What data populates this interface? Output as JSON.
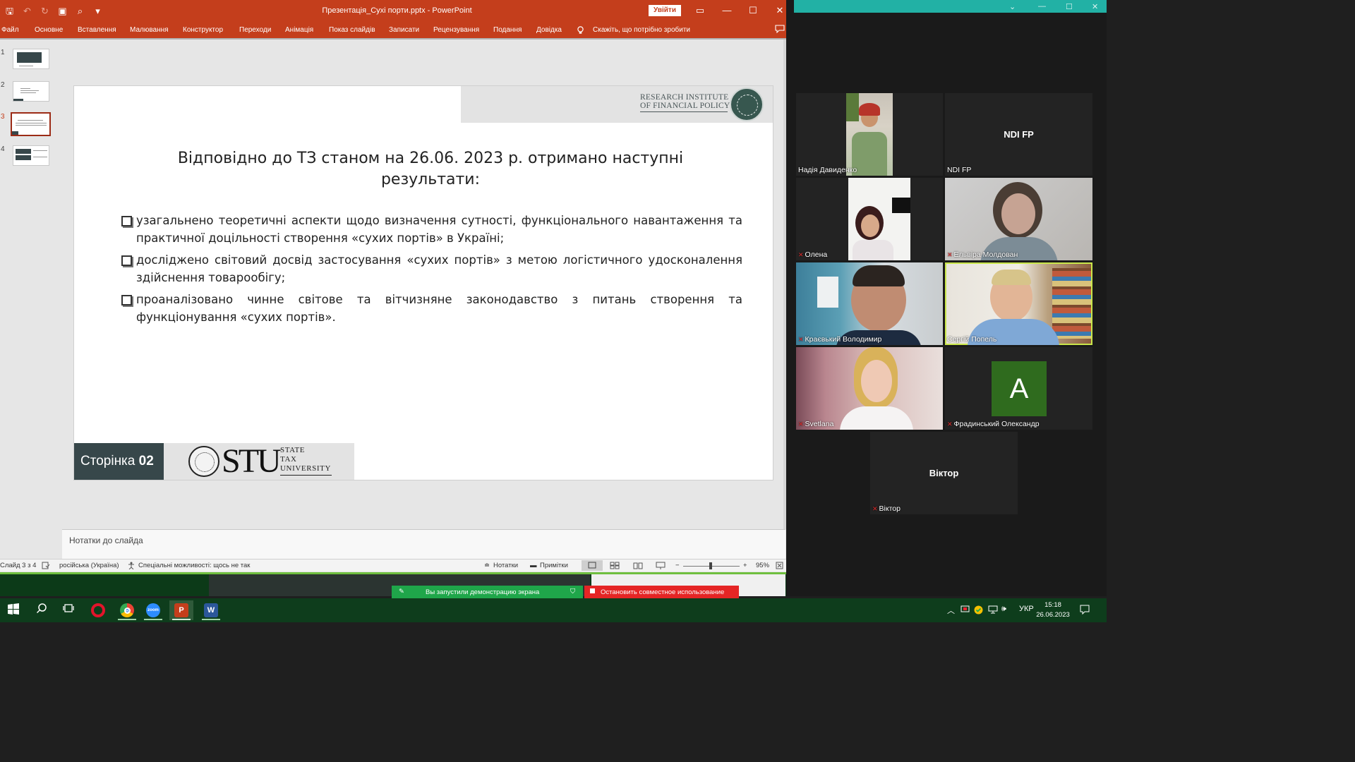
{
  "powerpoint": {
    "window_title": "Презентація_Сухі порти.pptx  -  PowerPoint",
    "signin_label": "Увійти",
    "qat": {
      "save": "🖫",
      "undo": "↶",
      "redo": "↻",
      "present": "▣",
      "preview": "⌕",
      "customize": "▾"
    },
    "window_controls": {
      "ribbon_display": "▭",
      "minimize": "—",
      "maximize": "☐",
      "close": "✕"
    },
    "ribbon_tabs": [
      "Файл",
      "Основне",
      "Вставлення",
      "Малювання",
      "Конструктор",
      "Переходи",
      "Анімація",
      "Показ слайдів",
      "Записати",
      "Рецензування",
      "Подання",
      "Довідка"
    ],
    "tellme": "Скажіть, що потрібно зробити",
    "thumbnails": [
      "1",
      "2",
      "3",
      "4"
    ],
    "selected_slide": 3,
    "slide": {
      "header_logo_line1": "RESEARCH INSTITUTE",
      "header_logo_line2": "OF FINANCIAL POLICY",
      "title": "Відповідно до ТЗ станом на 26.06. 2023 р. отримано наступні результати:",
      "bullets": [
        "узагальнено теоретичні аспекти щодо визначення сутності, функціонального навантаження та практичної доцільності створення «сухих портів» в Україні;",
        "досліджено світовий досвід застосування «сухих портів» з метою логістичного удосконалення здійснення товарообігу;",
        "проаналізовано чинне світове та вітчизняне законодавство з питань створення та функціонування «сухих портів»."
      ],
      "footer_page_label": "Сторінка",
      "footer_page_num": "02",
      "footer_logo_main": "STU",
      "footer_logo_sub1": "STATE",
      "footer_logo_sub2": "TAX",
      "footer_logo_sub3": "UNIVERSITY"
    },
    "notes_placeholder": "Нотатки до слайда",
    "status": {
      "slide_info": "Слайд 3 з 4",
      "language": "російська (Україна)",
      "accessibility": "Спеціальні можливості: щось не так",
      "notes_btn": "Нотатки",
      "comments_btn": "Примітки",
      "zoom_minus": "−",
      "zoom_plus": "+",
      "zoom": "95%"
    }
  },
  "zoom_meeting": {
    "window_controls": {
      "minimize": "—",
      "maximize": "☐",
      "close": "✕",
      "collapse": "⌄"
    },
    "participants": [
      {
        "name": "Надія Давиденко",
        "muted": false
      },
      {
        "name": "NDI FP",
        "muted": false,
        "label": "NDI FP"
      },
      {
        "name": "Олена",
        "muted": true
      },
      {
        "name": "Ельвіра Молдован",
        "muted": true
      },
      {
        "name": "Краєвький Володимир",
        "muted": true
      },
      {
        "name": "Сергій Попель",
        "muted": false
      },
      {
        "name": "Svetlana",
        "muted": true
      },
      {
        "name": "Фрадинський Олександр",
        "muted": true,
        "avatar": "A"
      },
      {
        "name": "Віктор",
        "muted": true,
        "label": "Віктор"
      }
    ],
    "share_banner": "Вы запустили демонстрацию экрана",
    "stop_share": "Остановить совместное использование"
  },
  "taskbar": {
    "apps": [
      "Opera",
      "Chrome",
      "Zoom",
      "PowerPoint",
      "Word"
    ],
    "zoom_app_label": "zoom",
    "powerpoint_glyph": "P",
    "word_glyph": "W",
    "chrome_glyph": "H",
    "language": "УКР",
    "time": "15:18",
    "date": "26.06.2023"
  },
  "colors": {
    "powerpoint_accent": "#c43e1c",
    "slide_dark": "#37474a",
    "zoom_accent": "#22b1a5",
    "taskbar": "#0e3d1c",
    "share_green": "#1fa64a",
    "share_red": "#e52525",
    "active_speaker": "#c9e64a"
  }
}
